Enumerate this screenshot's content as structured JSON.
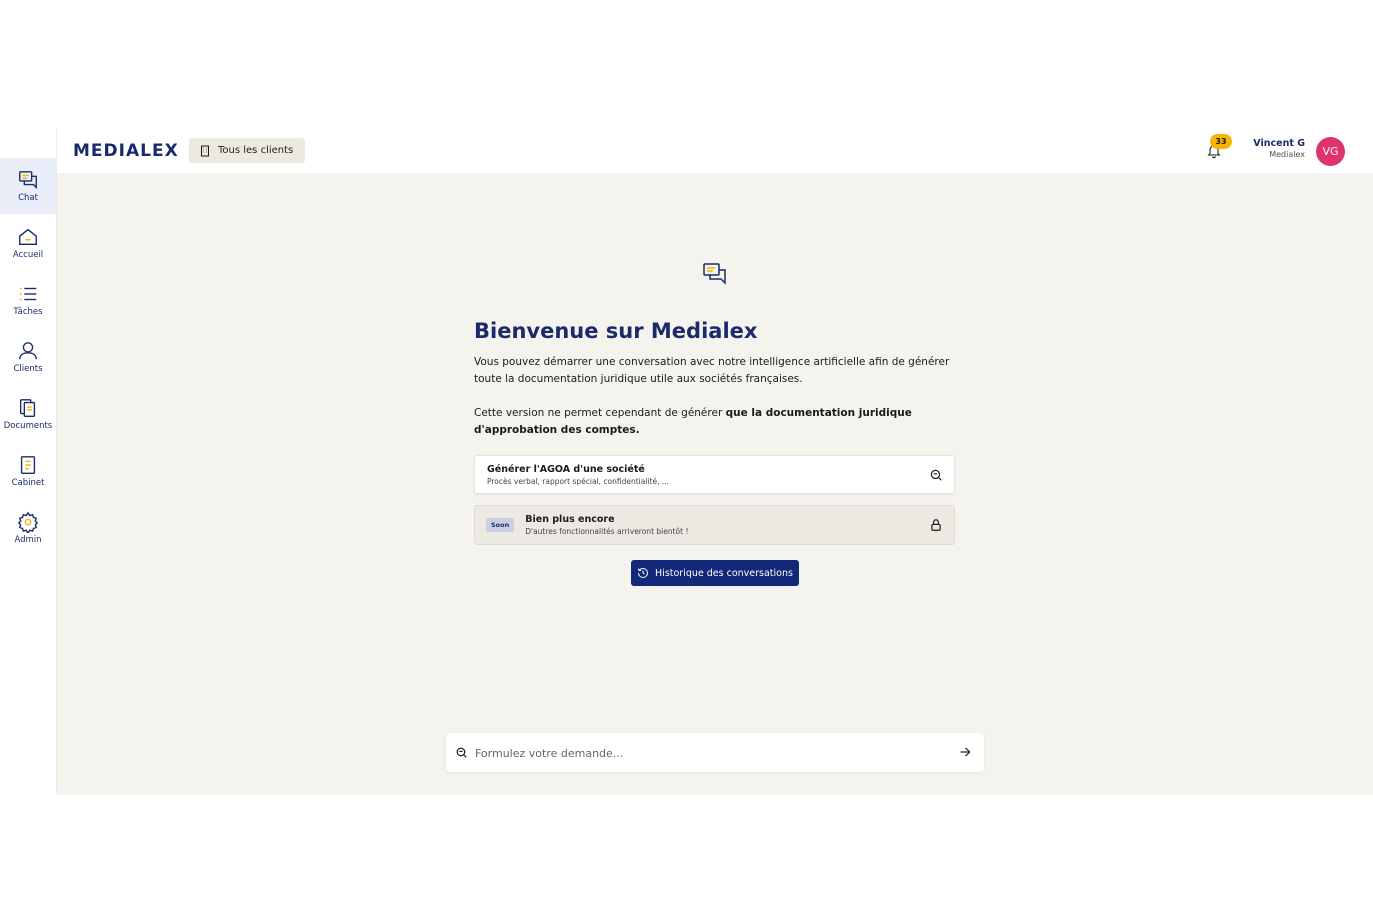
{
  "sidebar": {
    "items": [
      {
        "label": "Chat",
        "icon": "chat-icon"
      },
      {
        "label": "Accueil",
        "icon": "home-icon"
      },
      {
        "label": "Tâches",
        "icon": "list-icon"
      },
      {
        "label": "Clients",
        "icon": "user-icon"
      },
      {
        "label": "Documents",
        "icon": "documents-icon"
      },
      {
        "label": "Cabinet",
        "icon": "cabinet-icon"
      },
      {
        "label": "Admin",
        "icon": "gear-icon"
      }
    ],
    "active": "Chat"
  },
  "header": {
    "logo": "MEDIALEX",
    "clients_button": "Tous les clients",
    "notifications_count": "33",
    "user_name": "Vincent G",
    "user_org": "Medialex",
    "avatar_initials": "VG"
  },
  "main": {
    "title": "Bienvenue sur Medialex",
    "intro": "Vous pouvez démarrer une conversation avec notre intelligence artificielle afin de générer toute la documentation juridique utile aux sociétés françaises.",
    "version_note_prefix": "Cette version ne permet cependant de générer ",
    "version_note_bold": "que la documentation juridique d'approbation des comptes.",
    "cards": [
      {
        "title": "Générer l'AGOA d'une société",
        "subtitle": "Procès verbal, rapport spécial, confidentialité, ..."
      },
      {
        "badge": "Soon",
        "title": "Bien plus encore",
        "subtitle": "D'autres fonctionnalités arriveront bientôt !"
      }
    ],
    "history_button": "Historique des conversations",
    "input_placeholder": "Formulez votre demande..."
  },
  "colors": {
    "brand": "#1b2a6b",
    "primary_button": "#14287a",
    "badge": "#f4b400",
    "avatar": "#e0336e",
    "background": "#f5f3ee"
  }
}
